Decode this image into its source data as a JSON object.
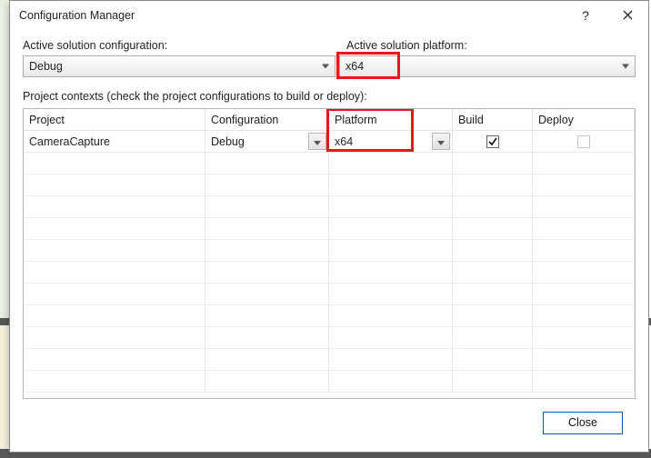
{
  "title": "Configuration Manager",
  "labels": {
    "active_config": "Active solution configuration:",
    "active_platform": "Active solution platform:",
    "context_hint": "Project contexts (check the project configurations to build or deploy):"
  },
  "active": {
    "config": "Debug",
    "platform": "x64"
  },
  "grid": {
    "headers": {
      "project": "Project",
      "configuration": "Configuration",
      "platform": "Platform",
      "build": "Build",
      "deploy": "Deploy"
    },
    "rows": [
      {
        "project": "CameraCapture",
        "configuration": "Debug",
        "platform": "x64",
        "build": true,
        "deploy": false,
        "deploy_disabled": true
      }
    ]
  },
  "buttons": {
    "close": "Close",
    "help_glyph": "?"
  },
  "highlights": {
    "platform_combo": true,
    "row_platform_cell": true
  }
}
